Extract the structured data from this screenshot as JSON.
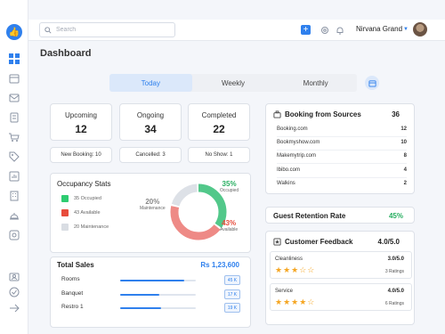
{
  "header": {
    "search_placeholder": "Search",
    "user_name": "Nirvana Grand"
  },
  "page_title": "Dashboard",
  "tabs": [
    {
      "label": "Today",
      "active": true
    },
    {
      "label": "Weekly",
      "active": false
    },
    {
      "label": "Monthly",
      "active": false
    }
  ],
  "stats": {
    "upcoming": {
      "label": "Upcoming",
      "value": "12"
    },
    "ongoing": {
      "label": "Ongoing",
      "value": "34"
    },
    "completed": {
      "label": "Completed",
      "value": "22"
    }
  },
  "sub_stats": {
    "new_booking": "New Booking: 10",
    "cancelled": "Cancelled: 3",
    "no_show": "No Show: 1"
  },
  "occupancy": {
    "title": "Occupancy Stats",
    "legend": [
      {
        "label": "35 Occupied",
        "color": "#2ecc71"
      },
      {
        "label": "43 Available",
        "color": "#e74c3c"
      },
      {
        "label": "20 Maintenance",
        "color": "#d9dde3"
      }
    ],
    "chart_data": {
      "type": "pie",
      "categories": [
        "Occupied",
        "Available",
        "Maintenance"
      ],
      "values": [
        35,
        43,
        20
      ],
      "colors": [
        "#52c88a",
        "#ee8a86",
        "#dde1e7"
      ],
      "labels": [
        {
          "pct": "35%",
          "name": "Occupied",
          "color": "#27ae60"
        },
        {
          "pct": "43%",
          "name": "Available",
          "color": "#e74c3c"
        },
        {
          "pct": "20%",
          "name": "Maintenance",
          "color": "#888888"
        }
      ]
    }
  },
  "sales": {
    "title": "Total Sales",
    "total": "Rs 1,23,600",
    "rows": [
      {
        "label": "Rooms",
        "badge": "45 K",
        "value": 45
      },
      {
        "label": "Banquet",
        "badge": "17 K",
        "value": 17
      },
      {
        "label": "Restro 1",
        "badge": "19 K",
        "value": 19
      }
    ]
  },
  "sources": {
    "title": "Booking from Sources",
    "total": "36",
    "rows": [
      {
        "name": "Booking.com",
        "value": "12"
      },
      {
        "name": "Bookmyshow.com",
        "value": "10"
      },
      {
        "name": "Makemytrip.com",
        "value": "8"
      },
      {
        "name": "Ibibo.com",
        "value": "4"
      },
      {
        "name": "Walkins",
        "value": "2"
      }
    ]
  },
  "retention": {
    "label": "Guest Retention Rate",
    "value": "45%"
  },
  "feedback": {
    "title": "Customer Feedback",
    "overall": "4.0/5.0",
    "items": [
      {
        "name": "Cleanliness",
        "score": "3.0/5.0",
        "ratings": "3 Ratings",
        "stars": "★★★☆☆"
      },
      {
        "name": "Service",
        "score": "4.0/5.0",
        "ratings": "6 Ratings",
        "stars": "★★★★☆"
      }
    ]
  }
}
